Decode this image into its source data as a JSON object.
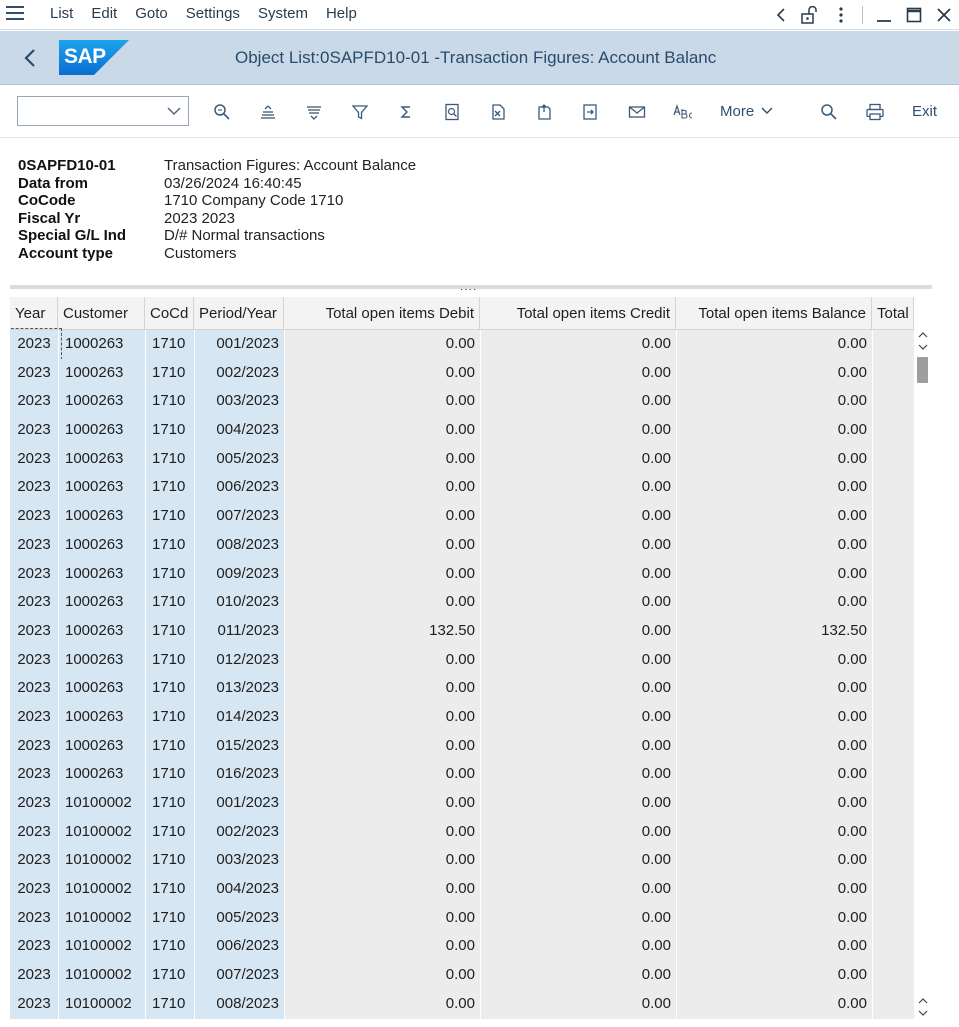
{
  "menu": {
    "items": [
      {
        "label": "List"
      },
      {
        "label": "Edit"
      },
      {
        "label": "Goto"
      },
      {
        "label": "Settings"
      },
      {
        "label": "System"
      },
      {
        "label": "Help"
      }
    ]
  },
  "titlebar": {
    "logo_text": "SAP",
    "title": "Object List:0SAPFD10-01 -Transaction Figures: Account Balanc"
  },
  "toolbar": {
    "select_value": "",
    "more_label": "More",
    "exit_label": "Exit",
    "icons": [
      "find-icon",
      "sort-ascending-icon",
      "sort-descending-icon",
      "filter-icon",
      "sum-icon",
      "print-preview-icon",
      "export-icon",
      "layout-icon",
      "send-icon",
      "mail-icon",
      "abc-analysis-icon",
      "search-icon",
      "print-icon"
    ]
  },
  "header_info": [
    {
      "label": "0SAPFD10-01",
      "value": "Transaction Figures: Account Balance"
    },
    {
      "label": "Data from",
      "value": "03/26/2024 16:40:45"
    },
    {
      "label": "CoCode",
      "value": "1710 Company Code 1710"
    },
    {
      "label": "Fiscal Yr",
      "value": "2023 2023"
    },
    {
      "label": "Special G/L Ind",
      "value": "D/# Normal transactions"
    },
    {
      "label": "Account type",
      "value": "Customers"
    }
  ],
  "splitter": "....",
  "table": {
    "columns": [
      "Year",
      "Customer",
      "CoCd",
      "Period/Year",
      "Total open items Debit",
      "Total open items Credit",
      "Total open items Balance",
      "Total"
    ],
    "rows": [
      [
        "2023",
        "1000263",
        "1710",
        "001/2023",
        "0.00",
        "0.00",
        "0.00"
      ],
      [
        "2023",
        "1000263",
        "1710",
        "002/2023",
        "0.00",
        "0.00",
        "0.00"
      ],
      [
        "2023",
        "1000263",
        "1710",
        "003/2023",
        "0.00",
        "0.00",
        "0.00"
      ],
      [
        "2023",
        "1000263",
        "1710",
        "004/2023",
        "0.00",
        "0.00",
        "0.00"
      ],
      [
        "2023",
        "1000263",
        "1710",
        "005/2023",
        "0.00",
        "0.00",
        "0.00"
      ],
      [
        "2023",
        "1000263",
        "1710",
        "006/2023",
        "0.00",
        "0.00",
        "0.00"
      ],
      [
        "2023",
        "1000263",
        "1710",
        "007/2023",
        "0.00",
        "0.00",
        "0.00"
      ],
      [
        "2023",
        "1000263",
        "1710",
        "008/2023",
        "0.00",
        "0.00",
        "0.00"
      ],
      [
        "2023",
        "1000263",
        "1710",
        "009/2023",
        "0.00",
        "0.00",
        "0.00"
      ],
      [
        "2023",
        "1000263",
        "1710",
        "010/2023",
        "0.00",
        "0.00",
        "0.00"
      ],
      [
        "2023",
        "1000263",
        "1710",
        "011/2023",
        "132.50",
        "0.00",
        "132.50"
      ],
      [
        "2023",
        "1000263",
        "1710",
        "012/2023",
        "0.00",
        "0.00",
        "0.00"
      ],
      [
        "2023",
        "1000263",
        "1710",
        "013/2023",
        "0.00",
        "0.00",
        "0.00"
      ],
      [
        "2023",
        "1000263",
        "1710",
        "014/2023",
        "0.00",
        "0.00",
        "0.00"
      ],
      [
        "2023",
        "1000263",
        "1710",
        "015/2023",
        "0.00",
        "0.00",
        "0.00"
      ],
      [
        "2023",
        "1000263",
        "1710",
        "016/2023",
        "0.00",
        "0.00",
        "0.00"
      ],
      [
        "2023",
        "10100002",
        "1710",
        "001/2023",
        "0.00",
        "0.00",
        "0.00"
      ],
      [
        "2023",
        "10100002",
        "1710",
        "002/2023",
        "0.00",
        "0.00",
        "0.00"
      ],
      [
        "2023",
        "10100002",
        "1710",
        "003/2023",
        "0.00",
        "0.00",
        "0.00"
      ],
      [
        "2023",
        "10100002",
        "1710",
        "004/2023",
        "0.00",
        "0.00",
        "0.00"
      ],
      [
        "2023",
        "10100002",
        "1710",
        "005/2023",
        "0.00",
        "0.00",
        "0.00"
      ],
      [
        "2023",
        "10100002",
        "1710",
        "006/2023",
        "0.00",
        "0.00",
        "0.00"
      ],
      [
        "2023",
        "10100002",
        "1710",
        "007/2023",
        "0.00",
        "0.00",
        "0.00"
      ],
      [
        "2023",
        "10100002",
        "1710",
        "008/2023",
        "0.00",
        "0.00",
        "0.00"
      ]
    ]
  },
  "colors": {
    "title_bg": "#c9d9e8",
    "key_cell_bg": "#d7e6f3",
    "value_cell_bg": "#ececec",
    "sap_blue": "#0a6ed1"
  }
}
